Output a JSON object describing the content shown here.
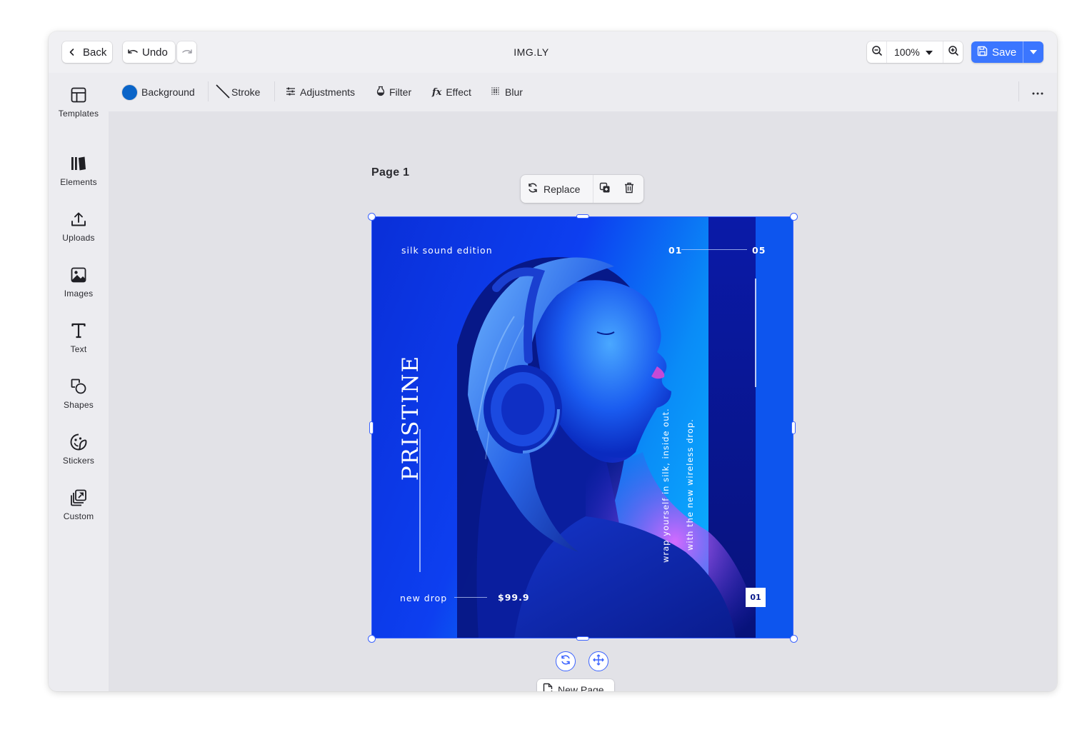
{
  "topbar": {
    "back_label": "Back",
    "undo_label": "Undo",
    "title": "IMG.LY",
    "zoom_value": "100%",
    "save_label": "Save"
  },
  "sidebar": {
    "items": [
      {
        "label": "Templates",
        "icon": "templates-icon"
      },
      {
        "label": "Elements",
        "icon": "elements-icon"
      },
      {
        "label": "Uploads",
        "icon": "upload-icon"
      },
      {
        "label": "Images",
        "icon": "image-icon"
      },
      {
        "label": "Text",
        "icon": "text-icon"
      },
      {
        "label": "Shapes",
        "icon": "shapes-icon"
      },
      {
        "label": "Stickers",
        "icon": "sticker-icon"
      },
      {
        "label": "Custom",
        "icon": "custom-icon"
      }
    ]
  },
  "toolbar": {
    "background_label": "Background",
    "background_color": "#0a64c8",
    "stroke_label": "Stroke",
    "adjustments_label": "Adjustments",
    "filter_label": "Filter",
    "effect_label": "Effect",
    "blur_label": "Blur"
  },
  "page": {
    "label": "Page 1",
    "replace_label": "Replace",
    "new_page_label": "New Page"
  },
  "poster": {
    "edition": "silk sound edition",
    "page_start": "01",
    "page_end": "05",
    "brand": "PRISTINE",
    "tagline_line1": "wrap yourself in silk, inside out.",
    "tagline_line2": "with the new wireless drop.",
    "drop_label": "new drop",
    "price": "$99.9",
    "badge": "01"
  },
  "colors": {
    "accent": "#3b76ff",
    "selection": "#3b63ff",
    "poster_blue": "#0a2bd0"
  }
}
